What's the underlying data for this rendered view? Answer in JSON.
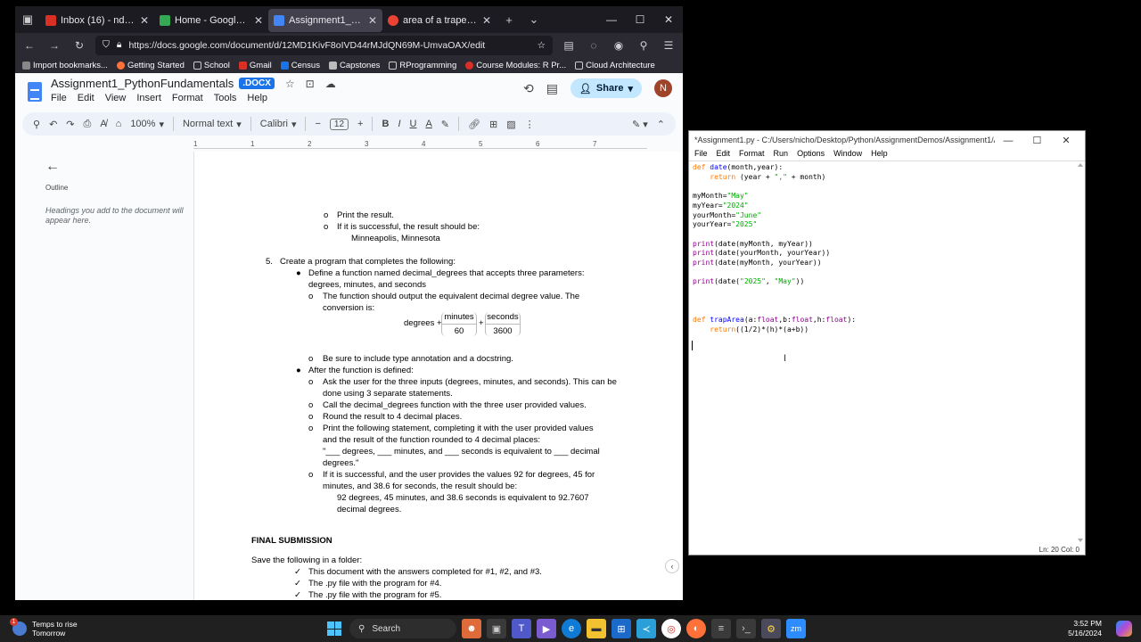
{
  "browser": {
    "tabs": [
      {
        "label": "Inbox (16) - ndimick@sm",
        "color": "#d93025",
        "active": false
      },
      {
        "label": "Home - Google Drive",
        "color": "#34a853",
        "active": false
      },
      {
        "label": "Assignment1_PythonFun",
        "color": "#4285f4",
        "active": true
      },
      {
        "label": "area of a trapezoid - Goo",
        "color": "#ea4335",
        "active": false
      }
    ],
    "new_tab": "+",
    "url": "https://docs.google.com/document/d/12MD1KivF8oIVD44rMJdQN69M-UmvaOAX/edit",
    "bookmarks": [
      {
        "label": "Import bookmarks...",
        "color": "#888888"
      },
      {
        "label": "Getting Started",
        "color": "#ff7139"
      },
      {
        "label": "School",
        "color": "#cccccc"
      },
      {
        "label": "Gmail",
        "color": "#d93025"
      },
      {
        "label": "Census",
        "color": "#1a73e8"
      },
      {
        "label": "Capstones",
        "color": "#bbbbbb"
      },
      {
        "label": "RProgramming",
        "color": "#cccccc"
      },
      {
        "label": "Course Modules: R Pr...",
        "color": "#d93025"
      },
      {
        "label": "Cloud Architecture",
        "color": "#cccccc"
      }
    ]
  },
  "docs": {
    "title": "Assignment1_PythonFundamentals",
    "badge": ".DOCX",
    "menus": [
      "File",
      "Edit",
      "View",
      "Insert",
      "Format",
      "Tools",
      "Help"
    ],
    "share_label": "Share",
    "avatar_letter": "N",
    "toolbar": {
      "zoom": "100%",
      "style": "Normal text",
      "font": "Calibri",
      "font_size": "12"
    },
    "ruler_ticks": [
      "1",
      "1",
      "2",
      "3",
      "4",
      "5",
      "6",
      "7"
    ],
    "outline": {
      "title": "Outline",
      "hint": "Headings you add to the document will appear here."
    },
    "page": {
      "l1": "Print the result.",
      "l2": "If it is successful, the result should be:",
      "l3": "Minneapolis, Minnesota",
      "l4_num": "5.",
      "l4": "Create a program that completes the following:",
      "l5": "Define a function named decimal_degrees that accepts three parameters:",
      "l6": "degrees, minutes, and seconds",
      "l7": "The function should output the equivalent decimal degree value. The",
      "l8": "conversion is:",
      "eq_degrees": "degrees +",
      "eq_minutes": "minutes",
      "eq_60": "60",
      "eq_plus": "+",
      "eq_seconds": "seconds",
      "eq_3600": "3600",
      "l9": "Be sure to include type annotation and a docstring.",
      "l10": "After the function is defined:",
      "l11": "Ask the user for the three inputs (degrees, minutes, and seconds). This can be",
      "l12": "done using 3 separate statements.",
      "l13": "Call the decimal_degrees function with the three user provided values.",
      "l14": "Round the result to 4 decimal places.",
      "l15": "Print the following statement, completing it with the user provided values",
      "l16": "and the result of the function rounded to 4 decimal places:",
      "l17": "\"___ degrees, ___ minutes, and ___ seconds is equivalent to ___ decimal",
      "l18": "degrees.\"",
      "l19": "If it is successful, and the user provides the values 92 for degrees, 45 for",
      "l20": "minutes, and 38.6 for seconds, the result should be:",
      "l21": "92 degrees, 45 minutes, and 38.6 seconds is equivalent to 92.7607",
      "l22": "decimal degrees.",
      "h_final": "FINAL SUBMISSION",
      "l23": "Save the following in a folder:",
      "l24": "This document with the answers completed for #1, #2, and #3.",
      "l25": "The .py file with the program for #4.",
      "l26": "The .py file with the program for #5."
    }
  },
  "idle": {
    "title": "*Assignment1.py - C:/Users/nicho/Desktop/Python/AssignmentDemos/Assignment1/Assign...",
    "menus": [
      "File",
      "Edit",
      "Format",
      "Run",
      "Options",
      "Window",
      "Help"
    ],
    "status": "Ln: 20   Col: 0"
  },
  "taskbar": {
    "weather_line1": "Temps to rise",
    "weather_line2": "Tomorrow",
    "search": "Search",
    "time": "3:52 PM",
    "date": "5/16/2024"
  }
}
